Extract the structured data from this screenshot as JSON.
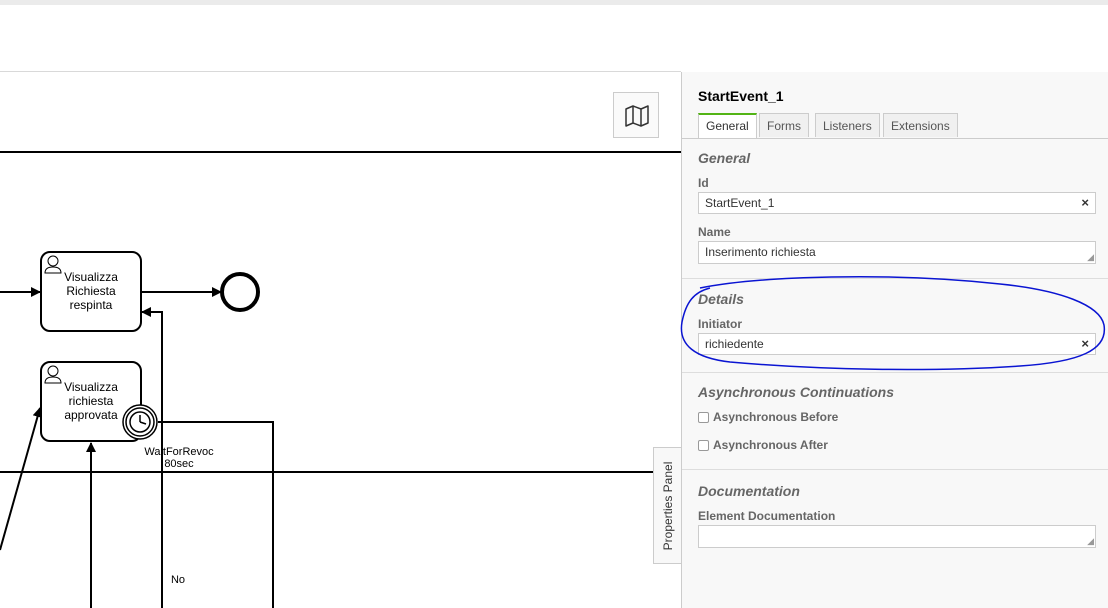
{
  "diagram": {
    "tasks": [
      {
        "label": "Visualizza\nRichiesta\nrespinta"
      },
      {
        "label": "Visualizza\nrichiesta\napprovata"
      }
    ],
    "timer_event_label": "WaitForRevoc\n80sec",
    "flow_label_no": "No"
  },
  "toolbar": {
    "minimap_icon": "map-icon"
  },
  "properties_panel": {
    "toggle_label": "Properties Panel",
    "element_title": "StartEvent_1",
    "tabs": [
      {
        "label": "General",
        "active": true
      },
      {
        "label": "Forms",
        "active": false
      },
      {
        "label": "Listeners",
        "active": false
      },
      {
        "label": "Extensions",
        "active": false
      }
    ],
    "general": {
      "title": "General",
      "id_label": "Id",
      "id_value": "StartEvent_1",
      "name_label": "Name",
      "name_value": "Inserimento richiesta"
    },
    "details": {
      "title": "Details",
      "initiator_label": "Initiator",
      "initiator_value": "richiedente"
    },
    "async": {
      "title": "Asynchronous Continuations",
      "before_label": "Asynchronous Before",
      "after_label": "Asynchronous After"
    },
    "documentation": {
      "title": "Documentation",
      "element_doc_label": "Element Documentation",
      "element_doc_value": ""
    },
    "clear_symbol": "×"
  },
  "colors": {
    "accent": "#52b415",
    "annotation": "#0a14d2",
    "panel_bg": "#f8f8f8"
  }
}
